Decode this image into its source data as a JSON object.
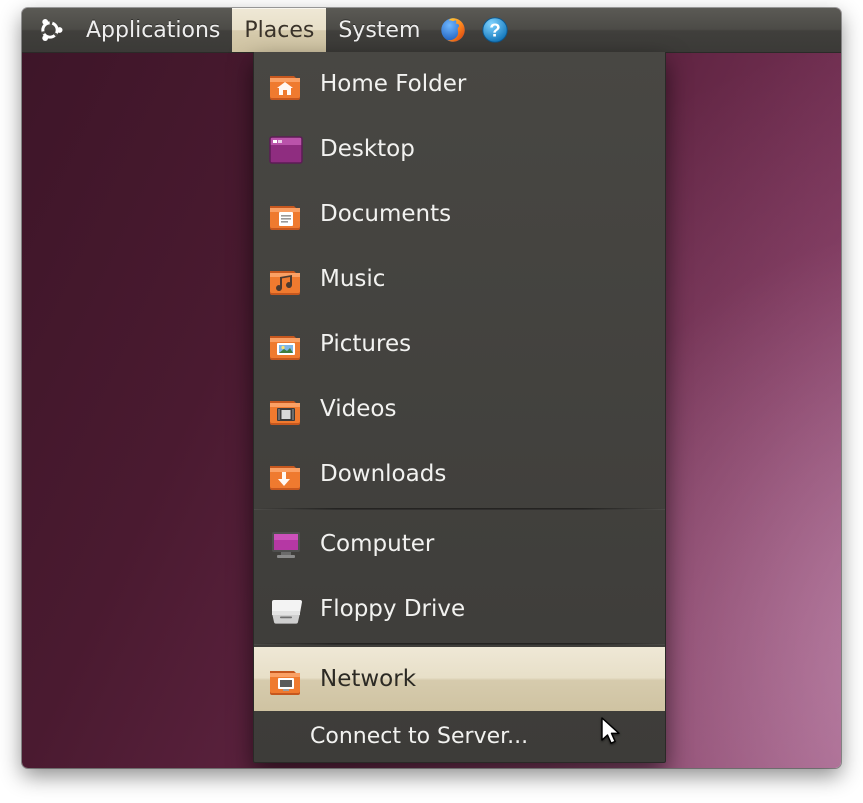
{
  "panel": {
    "menus": [
      {
        "id": "applications",
        "label": "Applications",
        "active": false
      },
      {
        "id": "places",
        "label": "Places",
        "active": true
      },
      {
        "id": "system",
        "label": "System",
        "active": false
      }
    ],
    "launchers": [
      {
        "id": "firefox",
        "name": "firefox-icon"
      },
      {
        "id": "help",
        "name": "help-icon"
      }
    ]
  },
  "places_menu": {
    "items": [
      {
        "id": "home",
        "label": "Home Folder",
        "icon": "home-folder-icon",
        "hovered": false
      },
      {
        "id": "desktop",
        "label": "Desktop",
        "icon": "desktop-icon",
        "hovered": false
      },
      {
        "id": "documents",
        "label": "Documents",
        "icon": "documents-folder-icon",
        "hovered": false
      },
      {
        "id": "music",
        "label": "Music",
        "icon": "music-folder-icon",
        "hovered": false
      },
      {
        "id": "pictures",
        "label": "Pictures",
        "icon": "pictures-folder-icon",
        "hovered": false
      },
      {
        "id": "videos",
        "label": "Videos",
        "icon": "videos-folder-icon",
        "hovered": false
      },
      {
        "id": "downloads",
        "label": "Downloads",
        "icon": "downloads-folder-icon",
        "hovered": false
      },
      {
        "sep": true
      },
      {
        "id": "computer",
        "label": "Computer",
        "icon": "computer-icon",
        "hovered": false
      },
      {
        "id": "floppy",
        "label": "Floppy Drive",
        "icon": "floppy-drive-icon",
        "hovered": false
      },
      {
        "sep": true
      },
      {
        "id": "network",
        "label": "Network",
        "icon": "network-folder-icon",
        "hovered": true
      },
      {
        "id": "connect",
        "label": "Connect to Server...",
        "icon": null,
        "hovered": false,
        "indented": true
      }
    ]
  },
  "colors": {
    "folder_orange": "#e86f24",
    "folder_orange_dark": "#c2551a",
    "purple": "#9a2d86",
    "panel_text": "#eeeeee"
  }
}
